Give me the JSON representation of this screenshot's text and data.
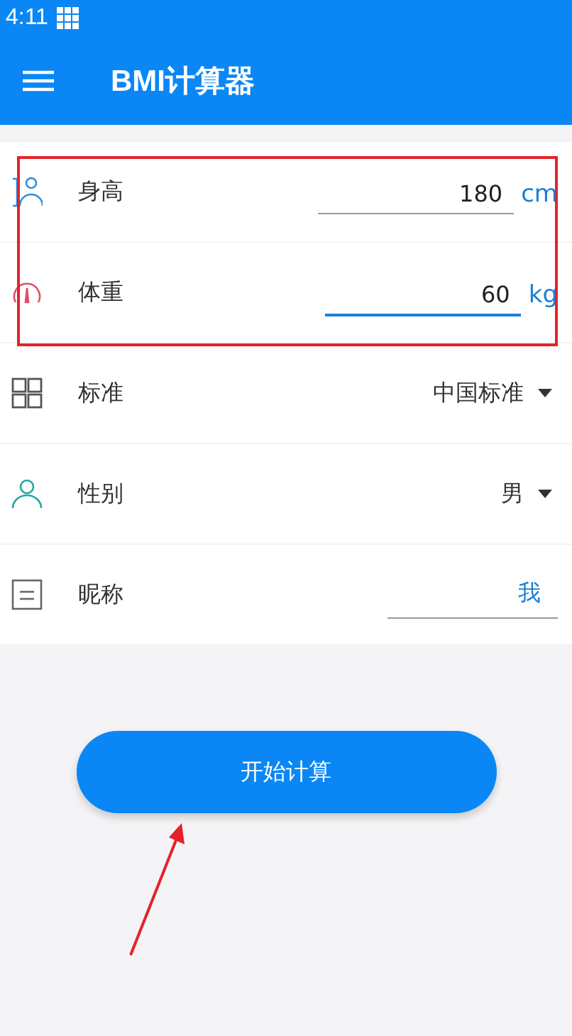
{
  "status_bar": {
    "time": "4:11"
  },
  "app_bar": {
    "title": "BMI计算器"
  },
  "form": [
    {
      "kind": "input",
      "label": "身高",
      "value": "180",
      "unit": "cm",
      "focused": false
    },
    {
      "kind": "input",
      "label": "体重",
      "value": "60",
      "unit": "kg",
      "focused": true
    },
    {
      "kind": "select",
      "label": "标准",
      "value": "中国标准"
    },
    {
      "kind": "select",
      "label": "性别",
      "value": "男"
    },
    {
      "kind": "text",
      "label": "昵称",
      "value": "我"
    }
  ],
  "button": {
    "label": "开始计算"
  }
}
